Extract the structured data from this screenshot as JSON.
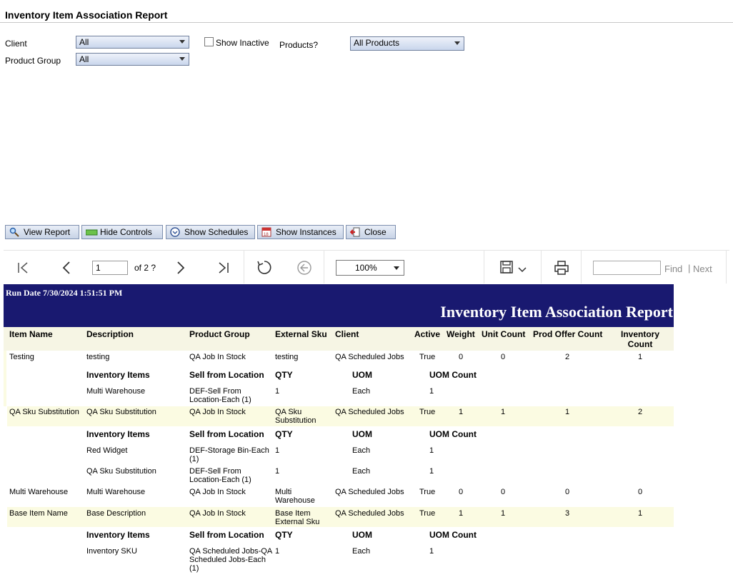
{
  "page_title": "Inventory Item Association Report",
  "params": {
    "client_label": "Client",
    "client_value": "All",
    "product_group_label": "Product Group",
    "product_group_value": "All",
    "show_inactive_label": "Show Inactive",
    "products_label": "Products?",
    "products_value": "All Products"
  },
  "buttons": {
    "view_report": "View Report",
    "hide_controls": "Hide Controls",
    "show_schedules": "Show Schedules",
    "show_instances": "Show Instances",
    "close": "Close"
  },
  "toolbar": {
    "page_value": "1",
    "page_of": "of 2 ?",
    "zoom": "100%",
    "find": "Find",
    "separator": "|",
    "next": "Next"
  },
  "report": {
    "run_date": "Run Date 7/30/2024 1:51:51 PM",
    "title": "Inventory Item Association Report",
    "columns": {
      "item_name": "Item Name",
      "description": "Description",
      "product_group": "Product Group",
      "external_sku": "External Sku",
      "client": "Client",
      "active": "Active",
      "weight": "Weight",
      "unit_count": "Unit Count",
      "prod_offer_count": "Prod Offer Count",
      "inventory_count": "Inventory Count"
    },
    "sub_columns": {
      "inventory_items": "Inventory Items",
      "sell_from_location": "Sell from Location",
      "qty": "QTY",
      "uom": "UOM",
      "uom_count": "UOM Count"
    },
    "rows": [
      {
        "item_name": "Testing",
        "description": "testing",
        "product_group": "QA Job In Stock",
        "external_sku": "testing",
        "client": "QA Scheduled Jobs",
        "active": "True",
        "weight": "0",
        "unit_count": "0",
        "prod_offer_count": "2",
        "inventory_count": "1",
        "inventory": [
          {
            "item": "Multi Warehouse",
            "location": "DEF-Sell From Location-Each (1)",
            "qty": "1",
            "uom": "Each",
            "uom_count": "1"
          }
        ]
      },
      {
        "item_name": "QA Sku Substitution",
        "description": "QA Sku Substitution",
        "product_group": "QA Job In Stock",
        "external_sku": "QA Sku Substitution",
        "client": "QA Scheduled Jobs",
        "active": "True",
        "weight": "1",
        "unit_count": "1",
        "prod_offer_count": "1",
        "inventory_count": "2",
        "inventory": [
          {
            "item": "Red Widget",
            "location": "DEF-Storage Bin-Each (1)",
            "qty": "1",
            "uom": "Each",
            "uom_count": "1"
          },
          {
            "item": "QA Sku Substitution",
            "location": "DEF-Sell From Location-Each (1)",
            "qty": "1",
            "uom": "Each",
            "uom_count": "1"
          }
        ]
      },
      {
        "item_name": "Multi Warehouse",
        "description": "Multi Warehouse",
        "product_group": "QA Job In Stock",
        "external_sku": "Multi Warehouse",
        "client": "QA Scheduled Jobs",
        "active": "True",
        "weight": "0",
        "unit_count": "0",
        "prod_offer_count": "0",
        "inventory_count": "0",
        "inventory": []
      },
      {
        "item_name": "Base Item Name",
        "description": "Base Description",
        "product_group": "QA Job In Stock",
        "external_sku": "Base Item External Sku",
        "client": "QA Scheduled Jobs",
        "active": "True",
        "weight": "1",
        "unit_count": "1",
        "prod_offer_count": "3",
        "inventory_count": "1",
        "inventory": [
          {
            "item": "Inventory SKU",
            "location": "QA Scheduled Jobs-QA Scheduled Jobs-Each (1)",
            "qty": "1",
            "uom": "Each",
            "uom_count": "1"
          }
        ]
      }
    ]
  }
}
